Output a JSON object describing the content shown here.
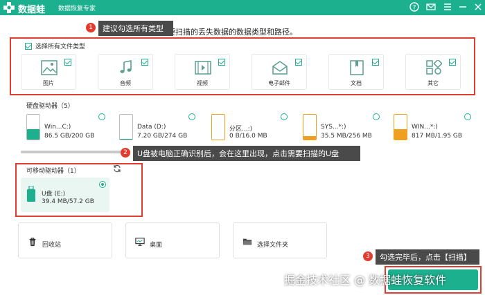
{
  "titlebar": {
    "app_name": "数据蛙",
    "app_subtitle": "数据恢复专家",
    "icons": [
      "help-icon",
      "mail-icon",
      "menu-icon",
      "minimize-icon",
      "close-icon"
    ]
  },
  "callouts": [
    {
      "num": "1",
      "text": "建议勾选所有类型"
    },
    {
      "num": "2",
      "text": "U盘被电脑正确识别后，会在这里出现，点击需要扫描的U盘"
    },
    {
      "num": "3",
      "text": "勾选完毕后，点击【扫描】"
    }
  ],
  "heading": "选择要扫描的丢失数据的数据类型和路径。",
  "file_types": {
    "select_all_label": "选择所有文件类型",
    "items": [
      {
        "label": "图片",
        "icon": "image-icon",
        "checked": true
      },
      {
        "label": "音频",
        "icon": "audio-icon",
        "checked": true
      },
      {
        "label": "视频",
        "icon": "video-icon",
        "checked": true
      },
      {
        "label": "电子邮件",
        "icon": "email-icon",
        "checked": true
      },
      {
        "label": "文档",
        "icon": "document-icon",
        "checked": true
      },
      {
        "label": "其它",
        "icon": "other-icon",
        "checked": true
      }
    ]
  },
  "hard_drives": {
    "title": "硬盘驱动器（5）",
    "items": [
      {
        "name": "Win...C:)",
        "size": "86.5 GB/200 GB",
        "usage": 0.43,
        "color": "#1db08f"
      },
      {
        "name": "Data (D:)",
        "size": "7.20 GB/274 GB",
        "usage": 0.03,
        "color": "#1db08f"
      },
      {
        "name": "分区...:)",
        "size": "0 B/16.0 MB",
        "usage": 0.0,
        "color": "#f0a020"
      },
      {
        "name": "SYS...*:)",
        "size": "35.5 MB/256 MB",
        "usage": 0.14,
        "color": "#f0a020"
      },
      {
        "name": "WIN...*:)",
        "size": "817 MB/1.95 GB",
        "usage": 0.41,
        "color": "#f0a020"
      }
    ]
  },
  "removable": {
    "title": "可移动驱动器（1）",
    "refresh_icon": "refresh-icon",
    "items": [
      {
        "name": "U盘 (E:)",
        "size": "39.4 MB/57.2 GB",
        "selected": true
      }
    ]
  },
  "locations": [
    {
      "label": "回收站",
      "icon": "recycle-bin-icon"
    },
    {
      "label": "桌面",
      "icon": "desktop-icon"
    },
    {
      "label": "选择文件夹",
      "icon": "folder-icon"
    }
  ],
  "watermark": "掘金技术社区 @ 数据蛙恢复软件",
  "colors": {
    "brand": "#1db08f",
    "annotation": "#e23b2f",
    "callout_bg": "#4a4a4a"
  }
}
